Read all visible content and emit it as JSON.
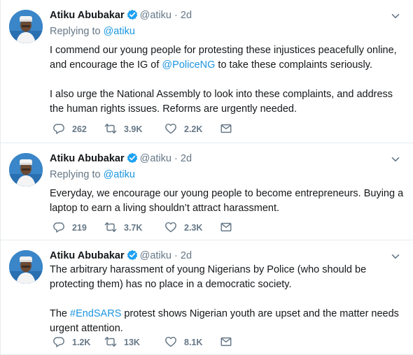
{
  "tweets": [
    {
      "name": "Atiku Abubakar",
      "handle": "@atiku",
      "separator": "·",
      "time": "2d",
      "replying_prefix": "Replying to",
      "replying_handle": "@atiku",
      "text_p1_a": "I commend our young people for protesting these injustices peacefully online, and encourage the IG of ",
      "text_p1_link": "@PoliceNG",
      "text_p1_b": " to take these complaints seriously.",
      "text_p2": "I also urge the National Assembly to look into these complaints, and address the human rights issues. Reforms are urgently needed.",
      "replies": "262",
      "retweets": "3.9K",
      "likes": "2.2K"
    },
    {
      "name": "Atiku Abubakar",
      "handle": "@atiku",
      "separator": "·",
      "time": "2d",
      "replying_prefix": "Replying to",
      "replying_handle": "@atiku",
      "text_p1": "Everyday, we encourage our young people to become entrepreneurs. Buying a laptop to earn a living shouldn’t attract harassment.",
      "replies": "219",
      "retweets": "3.7K",
      "likes": "2.3K"
    },
    {
      "name": "Atiku Abubakar",
      "handle": "@atiku",
      "separator": "·",
      "time": "2d",
      "text_p1": "The arbitrary harassment of young Nigerians by Police (who should be protecting them) has no place in a democratic society.",
      "text_p2_a": "The ",
      "text_p2_link": "#EndSARS",
      "text_p2_b": " protest shows Nigerian youth are upset and the matter needs urgent attention.",
      "replies": "1.2K",
      "retweets": "13K",
      "likes": "8.1K"
    }
  ],
  "colors": {
    "link": "#1b95e0",
    "muted": "#657786",
    "text": "#14171a",
    "verified": "#1da1f2",
    "border": "#e6ecf0"
  },
  "icons": [
    "avatar",
    "verified-badge-icon",
    "chevron-down-icon",
    "reply-icon",
    "retweet-icon",
    "like-icon",
    "direct-message-icon"
  ]
}
